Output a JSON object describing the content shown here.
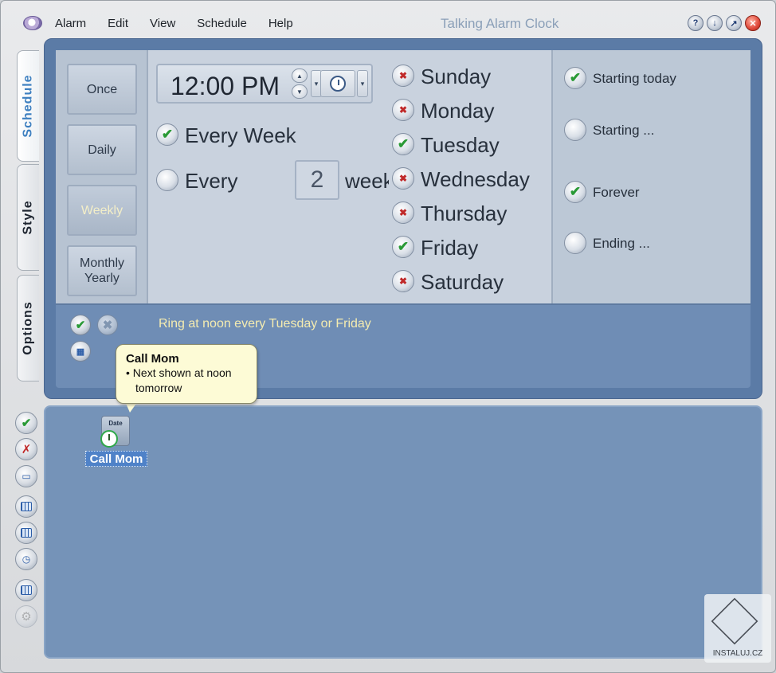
{
  "window": {
    "title": "Talking Alarm Clock"
  },
  "menu": [
    "Alarm",
    "Edit",
    "View",
    "Schedule",
    "Help"
  ],
  "window_buttons": {
    "help": "?",
    "minimize": "↓",
    "restore": "↗",
    "close": "✕"
  },
  "vertical_tabs": {
    "schedule": "Schedule",
    "style": "Style",
    "options": "Options",
    "active": "Schedule"
  },
  "schedule_types": {
    "once": "Once",
    "daily": "Daily",
    "weekly": "Weekly",
    "monthly_yearly_1": "Monthly",
    "monthly_yearly_2": "Yearly",
    "active": "Weekly"
  },
  "time": {
    "value": "12:00 PM",
    "spin_up": "▲",
    "spin_down": "▼",
    "dropdown": "▾"
  },
  "recurrence": {
    "every_week": {
      "label": "Every Week",
      "checked": true
    },
    "every_n": {
      "prefix": "Every",
      "value": "2",
      "suffix": "weeks",
      "checked": false
    }
  },
  "days": {
    "sunday": {
      "label": "Sunday",
      "state": "✖"
    },
    "monday": {
      "label": "Monday",
      "state": "✖"
    },
    "tuesday": {
      "label": "Tuesday",
      "state": "✔"
    },
    "wednesday": {
      "label": "Wednesday",
      "state": "✖"
    },
    "thursday": {
      "label": "Thursday",
      "state": "✖"
    },
    "friday": {
      "label": "Friday",
      "state": "✔"
    },
    "saturday": {
      "label": "Saturday",
      "state": "✖"
    }
  },
  "range": {
    "starting_today": {
      "label": "Starting today",
      "mark": "✔"
    },
    "starting": {
      "label": "Starting ...",
      "mark": ""
    },
    "forever": {
      "label": "Forever",
      "mark": "✔"
    },
    "ending": {
      "label": "Ending ...",
      "mark": ""
    }
  },
  "summary": "Ring at noon every Tuesday or Friday",
  "actions": {
    "accept": "✔",
    "cancel": "✖"
  },
  "callout": {
    "title": "Call Mom",
    "bullet": "•",
    "line1": "Next shown at noon",
    "line2": "tomorrow"
  },
  "alarm_item": {
    "icon_text": "Date",
    "name": "Call Mom"
  },
  "side_buttons": [
    "check-icon",
    "delete-icon",
    "monitor-icon",
    "grid-icon",
    "calendar-icon",
    "clock-calendar-icon",
    "calendar-week-icon",
    "disabled-icon"
  ],
  "watermark": {
    "text": "INSTALUJ.CZ"
  },
  "colors": {
    "accent": "#3d7fc0",
    "check": "#2a9a36",
    "cross": "#c02a2a",
    "summary_text": "#f5ecb0",
    "panel": "#5b7ba6"
  }
}
